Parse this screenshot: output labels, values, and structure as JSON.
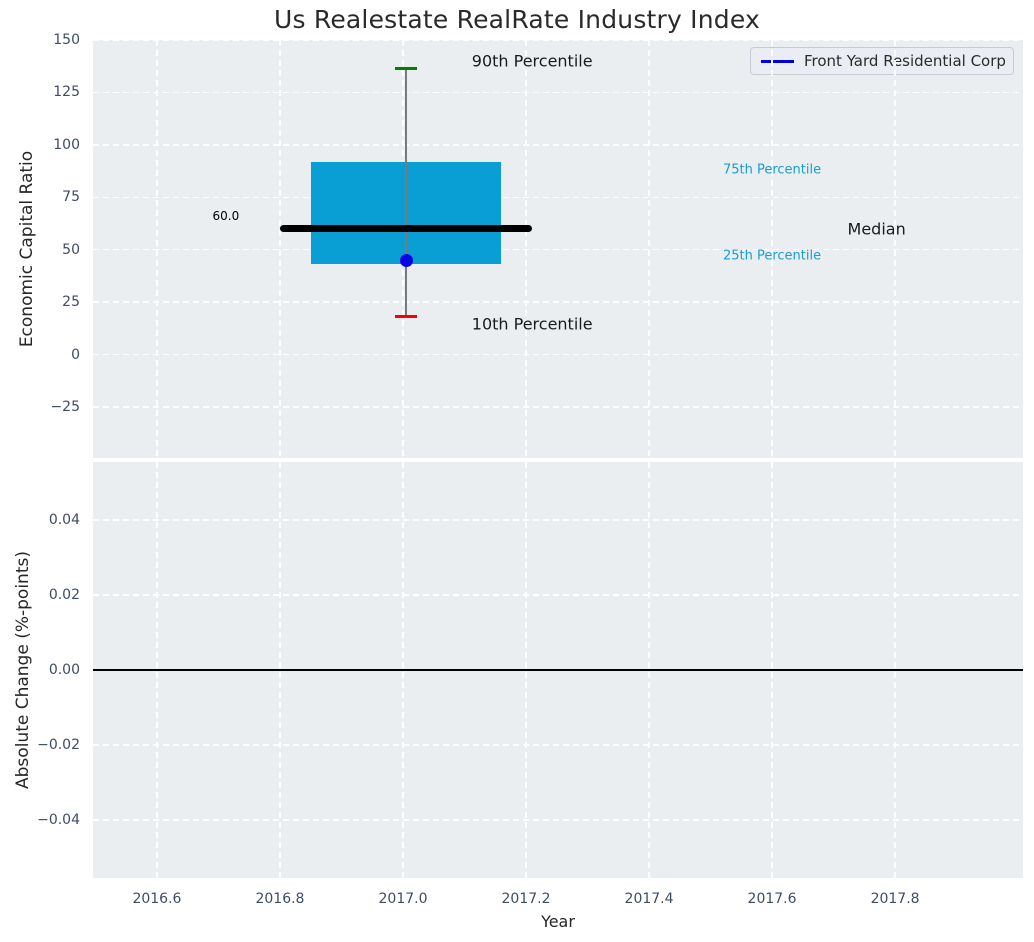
{
  "figure": {
    "title": "Us Realestate RealRate Industry Index",
    "legend": {
      "label": "Front Yard Residential Corp",
      "line_color": "#0000dd"
    }
  },
  "chart_data": [
    {
      "type": "box",
      "title": "Us Realestate RealRate Industry Index",
      "xlabel": "Year",
      "ylabel": "Economic Capital Ratio",
      "xlim": [
        2016.496,
        2018.008
      ],
      "ylim": [
        -49.3,
        150
      ],
      "xticks": [
        2016.6,
        2016.8,
        2017.0,
        2017.2,
        2017.4,
        2017.6,
        2017.8
      ],
      "xtick_labels": [
        "2016.6",
        "2016.8",
        "2017.0",
        "2017.2",
        "2017.4",
        "2017.6",
        "2017.8"
      ],
      "yticks": [
        150,
        125,
        100,
        75,
        50,
        25,
        0,
        -25
      ],
      "ytick_labels": [
        "150",
        "125",
        "100",
        "75",
        "50",
        "25",
        "0",
        "−25"
      ],
      "grid": true,
      "legend_position": "upper right",
      "box": {
        "x_center": 2017.005,
        "box_left": 2016.85,
        "box_right": 2017.16,
        "q1": 43.2,
        "q3": 91.8,
        "median": 60.0,
        "median_left": 2016.8,
        "median_right": 2017.21,
        "p10": 18.4,
        "p90": 136.2,
        "cap_halfwidth": 0.018,
        "company_point": {
          "x": 2017.005,
          "y": 45.0
        },
        "box_color": "#0a9fd4",
        "median_color": "#000000",
        "whisker_color": "#7a7a7a",
        "p90_cap_color": "#008000",
        "p10_cap_color": "#fb0000",
        "company_point_color": "#0707e3"
      },
      "annotations": [
        {
          "text": "90th Percentile",
          "x": 2017.21,
          "y": 140.0,
          "color": "#1a1a1a",
          "size": 16
        },
        {
          "text": "10th Percentile",
          "x": 2017.21,
          "y": 14.5,
          "color": "#1a1a1a",
          "size": 16
        },
        {
          "text": "Median",
          "x": 2017.77,
          "y": 60.0,
          "color": "#1a1a1a",
          "size": 16
        },
        {
          "text": "75th Percentile",
          "x": 2017.6,
          "y": 88.0,
          "color": "#189dd1",
          "size": 13
        },
        {
          "text": "25th Percentile",
          "x": 2017.6,
          "y": 47.0,
          "color": "#189dd1",
          "size": 13
        },
        {
          "text": "60.0",
          "x": 2016.712,
          "y": 66.0,
          "color": "#000000",
          "size": 12
        }
      ]
    },
    {
      "type": "line",
      "xlabel": "Year",
      "ylabel": "Absolute Change (%-points)",
      "xlim": [
        2016.496,
        2018.008
      ],
      "ylim": [
        -0.0555,
        0.0555
      ],
      "yticks": [
        0.04,
        0.02,
        0.0,
        -0.02,
        -0.04
      ],
      "ytick_labels": [
        "0.04",
        "0.02",
        "0.00",
        "−0.02",
        "−0.04"
      ],
      "grid": true,
      "zero_line": 0.0,
      "zero_line_color": "#000000",
      "series": []
    }
  ]
}
